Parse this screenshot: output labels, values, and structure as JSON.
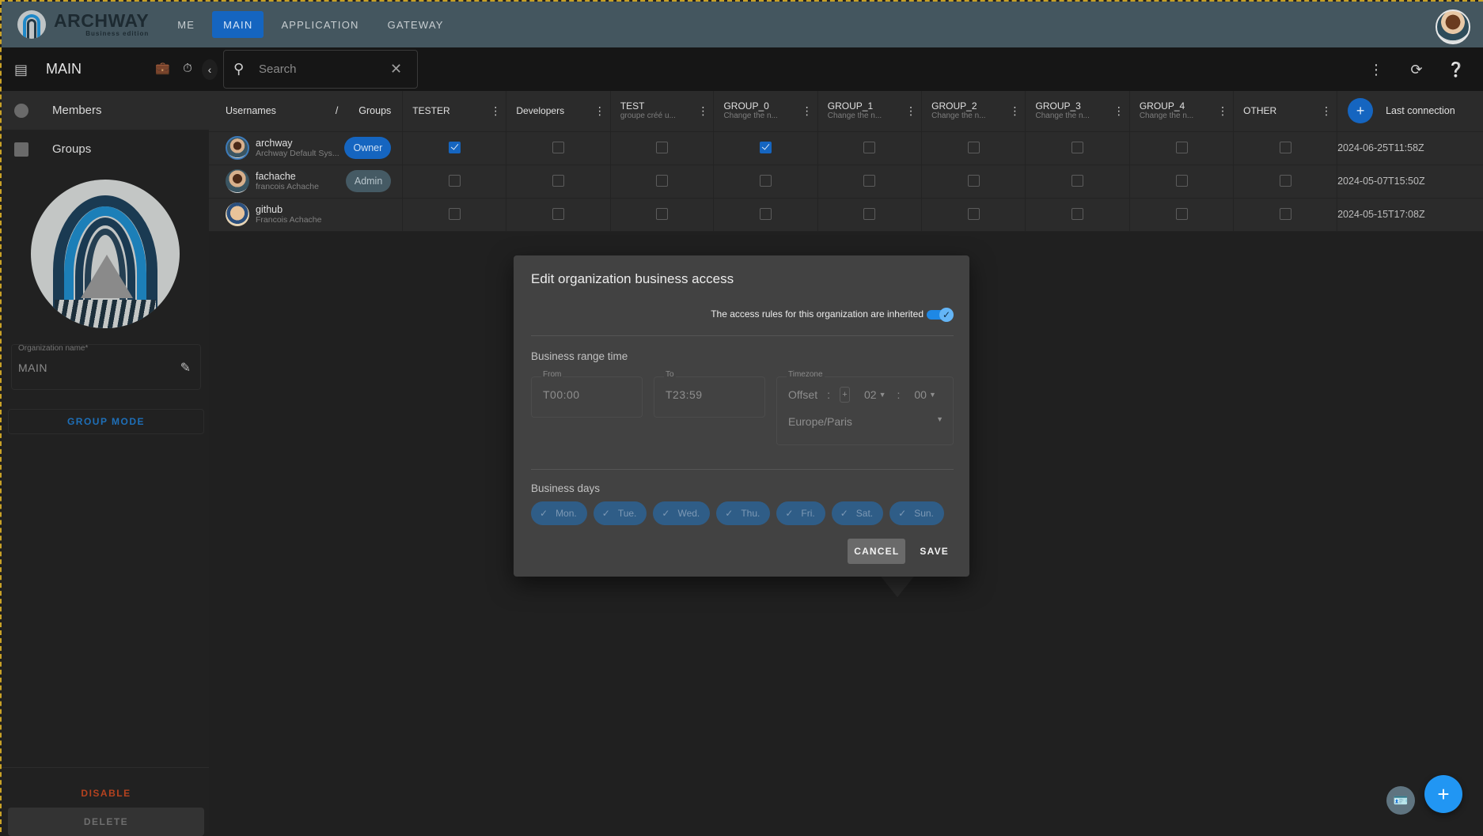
{
  "app": {
    "brand": "ARCHWAY",
    "edition": "Business edition"
  },
  "nav": {
    "tabs": [
      {
        "label": "ME",
        "active": false
      },
      {
        "label": "MAIN",
        "active": true
      },
      {
        "label": "APPLICATION",
        "active": false
      },
      {
        "label": "GATEWAY",
        "active": false
      }
    ]
  },
  "toolbar": {
    "title": "MAIN",
    "search_placeholder": "Search",
    "search_value": "",
    "icons": [
      "business-hours-icon",
      "timer-icon",
      "collapse-left-icon",
      "more-vert-icon",
      "sync-icon",
      "help-icon"
    ]
  },
  "sidebar": {
    "items": [
      {
        "label": "Members",
        "active": true
      },
      {
        "label": "Groups",
        "active": false
      }
    ],
    "org_field_label": "Organization name*",
    "org_field_value": "MAIN",
    "group_mode_label": "GROUP MODE",
    "disable_label": "DISABLE",
    "delete_label": "DELETE"
  },
  "table": {
    "header_usernames": "Usernames",
    "header_separator": "/",
    "header_groups": "Groups",
    "header_last_connection": "Last connection",
    "groups": [
      {
        "name": "TESTER",
        "description": ""
      },
      {
        "name": "Developers",
        "description": ""
      },
      {
        "name": "TEST",
        "description": "groupe créé u..."
      },
      {
        "name": "GROUP_0",
        "description": "Change the n..."
      },
      {
        "name": "GROUP_1",
        "description": "Change the n..."
      },
      {
        "name": "GROUP_2",
        "description": "Change the n..."
      },
      {
        "name": "GROUP_3",
        "description": "Change the n..."
      },
      {
        "name": "GROUP_4",
        "description": "Change the n..."
      },
      {
        "name": "OTHER",
        "description": ""
      }
    ],
    "rows": [
      {
        "username": "archway",
        "description": "Archway Default Sys...",
        "role": "Owner",
        "memberships": [
          true,
          false,
          false,
          true,
          false,
          false,
          false,
          false,
          false
        ],
        "last_connection": "2024-06-25T11:58Z"
      },
      {
        "username": "fachache",
        "description": "francois Achache",
        "role": "Admin",
        "memberships": [
          false,
          false,
          false,
          false,
          false,
          false,
          false,
          false,
          false
        ],
        "last_connection": "2024-05-07T15:50Z"
      },
      {
        "username": "github",
        "description": "Francois Achache",
        "role": "",
        "memberships": [
          false,
          false,
          false,
          false,
          false,
          false,
          false,
          false,
          false
        ],
        "last_connection": "2024-05-15T17:08Z"
      }
    ]
  },
  "dialog": {
    "title": "Edit organization business access",
    "inherit_label": "The access rules for this organization are inherited",
    "inherit_enabled": true,
    "range_section": "Business range time",
    "from_label": "From",
    "from_value": "T00:00",
    "to_label": "To",
    "to_value": "T23:59",
    "timezone_label": "Timezone",
    "offset_label": "Offset",
    "offset_sign": "+",
    "offset_hours": "02",
    "offset_minutes": "00",
    "timezone_value": "Europe/Paris",
    "days_section": "Business days",
    "days": [
      {
        "label": "Mon.",
        "selected": true
      },
      {
        "label": "Tue.",
        "selected": true
      },
      {
        "label": "Wed.",
        "selected": true
      },
      {
        "label": "Thu.",
        "selected": true
      },
      {
        "label": "Fri.",
        "selected": true
      },
      {
        "label": "Sat.",
        "selected": true
      },
      {
        "label": "Sun.",
        "selected": true
      }
    ],
    "cancel_label": "CANCEL",
    "save_label": "SAVE"
  },
  "colors": {
    "accent": "#1565c0",
    "appbar": "#44565f",
    "danger": "#b5421f",
    "fab": "#2196f3"
  }
}
